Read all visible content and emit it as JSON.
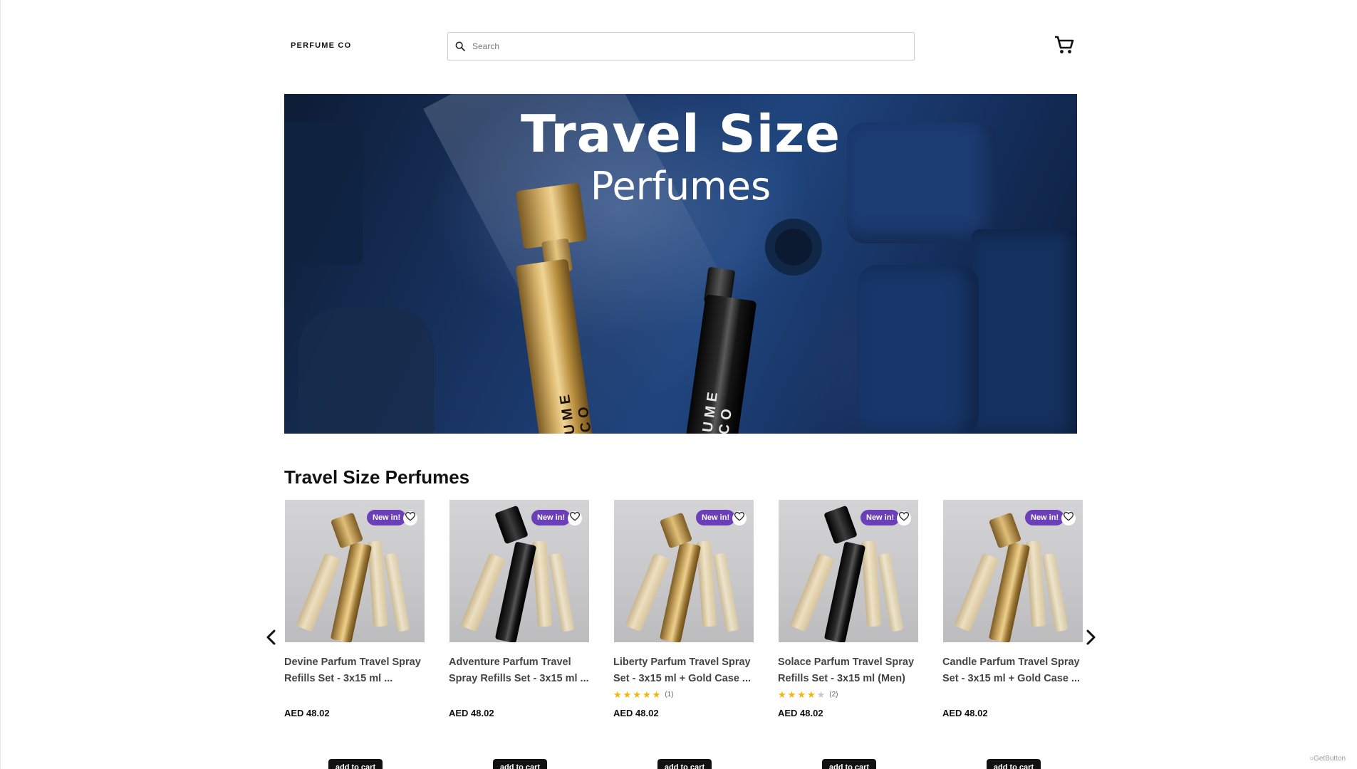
{
  "header": {
    "logo": "PERFUME CO",
    "search_placeholder": "Search"
  },
  "hero": {
    "title": "Travel Size",
    "subtitle": "Perfumes",
    "bottle_text": "UME CO"
  },
  "section": {
    "title": "Travel Size Perfumes"
  },
  "products": [
    {
      "name": "Devine Parfum Travel Spray Refills Set - 3x15 ml  ...",
      "badge": "New in!",
      "price": "AED 48.02",
      "button": "add to cart",
      "bottle": "gold",
      "rating": null,
      "rating_count": ""
    },
    {
      "name": "Adventure Parfum Travel Spray Refills Set - 3x15 ml  ...",
      "badge": "New in!",
      "price": "AED 48.02",
      "button": "add to cart",
      "bottle": "black",
      "rating": null,
      "rating_count": ""
    },
    {
      "name": "Liberty Parfum Travel Spray Set - 3x15 ml + Gold Case  ...",
      "badge": "New in!",
      "price": "AED 48.02",
      "button": "add to cart",
      "bottle": "gold",
      "rating": 5,
      "rating_count": "(1)"
    },
    {
      "name": "Solace Parfum Travel Spray Refills Set - 3x15 ml  (Men)",
      "badge": "New in!",
      "price": "AED 48.02",
      "button": "add to cart",
      "bottle": "black",
      "rating": 4,
      "rating_count": "(2)"
    },
    {
      "name": "Candle Parfum Travel Spray Set - 3x15 ml + Gold Case  ...",
      "badge": "New in!",
      "price": "AED 48.02",
      "button": "add to cart",
      "bottle": "gold",
      "rating": null,
      "rating_count": ""
    }
  ],
  "footer": {
    "getbutton": "GetButton"
  },
  "colors": {
    "badge": "#6b3fb8",
    "star": "#f4b400",
    "button": "#111111"
  },
  "icons": {
    "search": "search-icon",
    "cart": "cart-icon",
    "prev": "chevron-left-icon",
    "next": "chevron-right-icon",
    "wishlist": "heart-icon",
    "star": "star-icon"
  }
}
